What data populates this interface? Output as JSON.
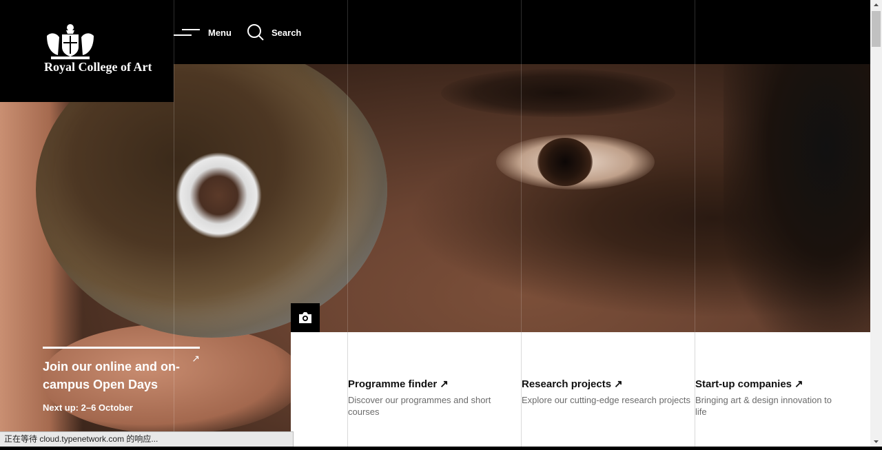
{
  "header": {
    "logo_text": "Royal College of Art",
    "menu_label": "Menu",
    "search_label": "Search"
  },
  "promo": {
    "title": "Join our online and on-campus Open Days",
    "arrow": "↗",
    "next_up": "Next up: 2–6 October"
  },
  "cards": [
    {
      "title": "Programme finder",
      "arrow": "↗",
      "description": "Discover our programmes and short courses"
    },
    {
      "title": "Research projects",
      "arrow": "↗",
      "description": "Explore our cutting-edge research projects"
    },
    {
      "title": "Start-up companies",
      "arrow": "↗",
      "description": "Bringing art & design innovation to life"
    }
  ],
  "status_bar": {
    "text": "正在等待 cloud.typenetwork.com 的响应..."
  },
  "icons": {
    "crest": "royal-crest-icon",
    "menu": "hamburger-icon",
    "search": "search-icon",
    "camera": "camera-icon",
    "card_arrow": "arrow-up-right-icon"
  },
  "colors": {
    "header_bg": "#000000",
    "panel_bg": "#ffffff",
    "description_text": "#6b6b6b"
  }
}
